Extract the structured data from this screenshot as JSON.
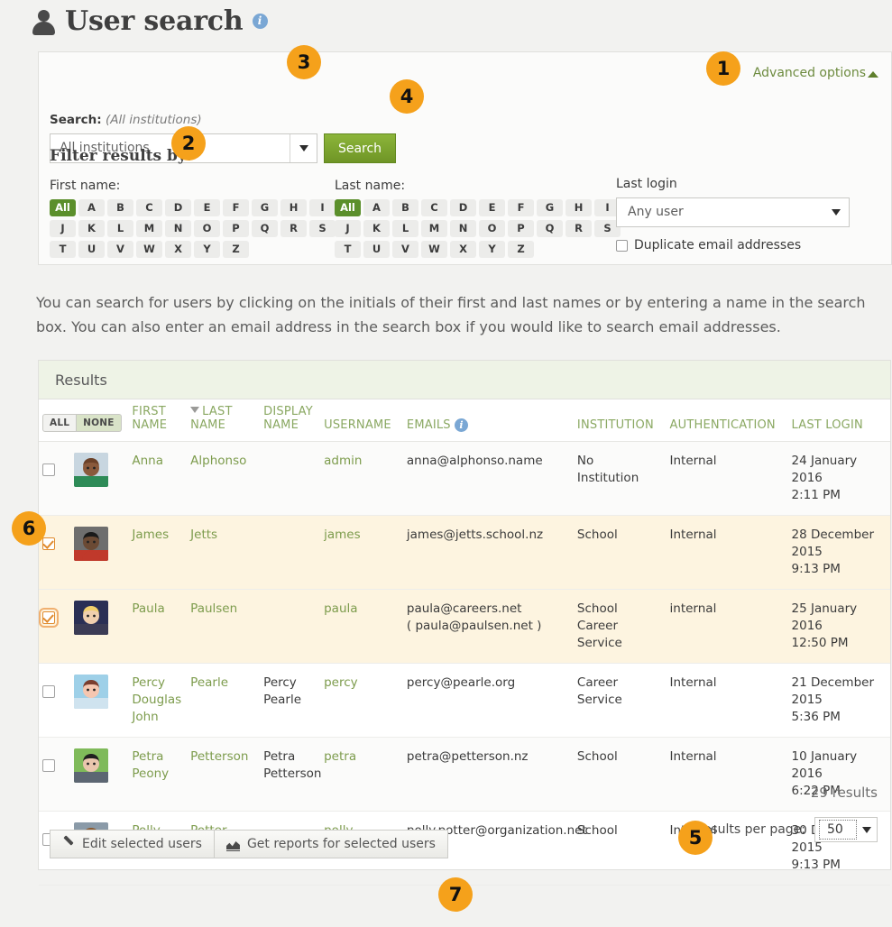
{
  "page": {
    "title": "User search",
    "title_icon": "user-icon",
    "info_icon": "info-icon",
    "intro_text": "You can search for users by clicking on the initials of their first and last names or by entering a name in the search box. You can also enter an email address in the search box if you would like to search email addresses."
  },
  "search_panel": {
    "advanced_options_label": "Advanced options",
    "advanced_options_icon": "chevron-up-icon",
    "search_label": "Search:",
    "search_scope_note": "(All institutions)",
    "institution_select_value": "All institutions",
    "search_button_label": "Search",
    "filter_title": "Filter results by:",
    "first_name_label": "First name:",
    "last_name_label": "Last name:",
    "letters": [
      "All",
      "A",
      "B",
      "C",
      "D",
      "E",
      "F",
      "G",
      "H",
      "I",
      "J",
      "K",
      "L",
      "M",
      "N",
      "O",
      "P",
      "Q",
      "R",
      "S",
      "T",
      "U",
      "V",
      "W",
      "X",
      "Y",
      "Z"
    ],
    "first_name_selected": "All",
    "last_name_selected": "All",
    "last_login_label": "Last login",
    "last_login_value": "Any user",
    "duplicate_email_label": "Duplicate email addresses",
    "duplicate_email_checked": false
  },
  "results": {
    "panel_title": "Results",
    "select_all_label": "ALL",
    "select_none_label": "NONE",
    "columns": {
      "first_name": "FIRST NAME",
      "last_name": "LAST NAME",
      "display_name": "DISPLAY NAME",
      "username": "USERNAME",
      "emails": "EMAILS",
      "institution": "INSTITUTION",
      "authentication": "AUTHENTICATION",
      "last_login": "LAST LOGIN"
    },
    "sorted_column": "LAST NAME",
    "sort_direction_icon": "sort-descending-icon",
    "emails_info_icon": "info-icon",
    "rows": [
      {
        "selected": false,
        "first_name": "Anna",
        "last_name": "Alphonso",
        "display_name": "",
        "username": "admin",
        "emails": "anna@alphonso.name",
        "institution": "No Institution",
        "authentication": "Internal",
        "last_login": "24 January 2016, 2:11 PM"
      },
      {
        "selected": true,
        "first_name": "James",
        "last_name": "Jetts",
        "display_name": "",
        "username": "james",
        "emails": "james@jetts.school.nz",
        "institution": "School",
        "authentication": "Internal",
        "last_login": "28 December 2015, 9:13 PM"
      },
      {
        "selected": true,
        "first_name": "Paula",
        "last_name": "Paulsen",
        "display_name": "",
        "username": "paula",
        "emails": "paula@careers.net ( paula@paulsen.net )",
        "institution": "School Career Service",
        "authentication": "internal",
        "last_login": "25 January 2016, 12:50 PM"
      },
      {
        "selected": false,
        "first_name": "Percy Douglas John",
        "last_name": "Pearle",
        "display_name": "Percy Pearle",
        "username": "percy",
        "emails": "percy@pearle.org",
        "institution": "Career Service",
        "authentication": "Internal",
        "last_login": "21 December 2015, 5:36 PM"
      },
      {
        "selected": false,
        "first_name": "Petra Peony",
        "last_name": "Petterson",
        "display_name": "Petra Petterson",
        "username": "petra",
        "emails": "petra@petterson.nz",
        "institution": "School",
        "authentication": "Internal",
        "last_login": "10 January 2016, 6:22 PM"
      },
      {
        "selected": false,
        "first_name": "Polly",
        "last_name": "Potter",
        "display_name": "",
        "username": "polly",
        "emails": "polly.potter@organization.net",
        "institution": "School",
        "authentication": "Internal",
        "last_login": "30 December 2015, 9:13 PM"
      }
    ],
    "result_count_text": "29 results",
    "results_per_page_label": "Results per page:",
    "results_per_page_value": "50"
  },
  "actions": {
    "edit_selected_label": "Edit selected users",
    "edit_selected_icon": "pencil-icon",
    "get_reports_label": "Get reports for selected users",
    "get_reports_icon": "chart-icon"
  },
  "markers": {
    "m1": "1",
    "m2": "2",
    "m3": "3",
    "m4": "4",
    "m5": "5",
    "m6": "6",
    "m7": "7"
  },
  "colors": {
    "accent_green": "#7ba32d",
    "letter_all_green": "#5b8f2b",
    "link_green": "#7d9c4d",
    "marker_orange": "#f5a11b",
    "selected_row": "#fdf4e0",
    "checked_box": "#e08b2e",
    "info_blue": "#7aa7d4",
    "panel_header_green": "#eef3e6"
  }
}
